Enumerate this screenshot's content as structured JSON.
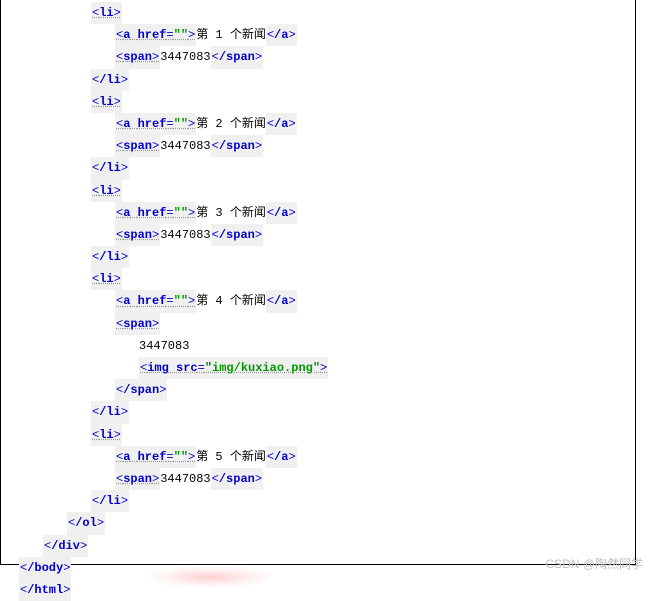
{
  "code": {
    "tags": {
      "li_open": "li",
      "li_close": "/li",
      "a_open": "a",
      "a_close": "/a",
      "span_open": "span",
      "span_close": "/span",
      "ol_close": "/ol",
      "div_close": "/div",
      "body_close": "/body",
      "html_close": "/html",
      "img": "img"
    },
    "attrs": {
      "href": "href",
      "src": "src",
      "href_val": "\"\"",
      "src_val": "\"img/kuxiao.png\""
    },
    "text": {
      "news1": "第 1 个新闻",
      "news2": "第 2 个新闻",
      "news3": "第 3 个新闻",
      "news4": "第 4 个新闻",
      "news5": "第 5 个新闻",
      "count": "3447083"
    }
  },
  "watermark": "CSDN @陶然同学"
}
